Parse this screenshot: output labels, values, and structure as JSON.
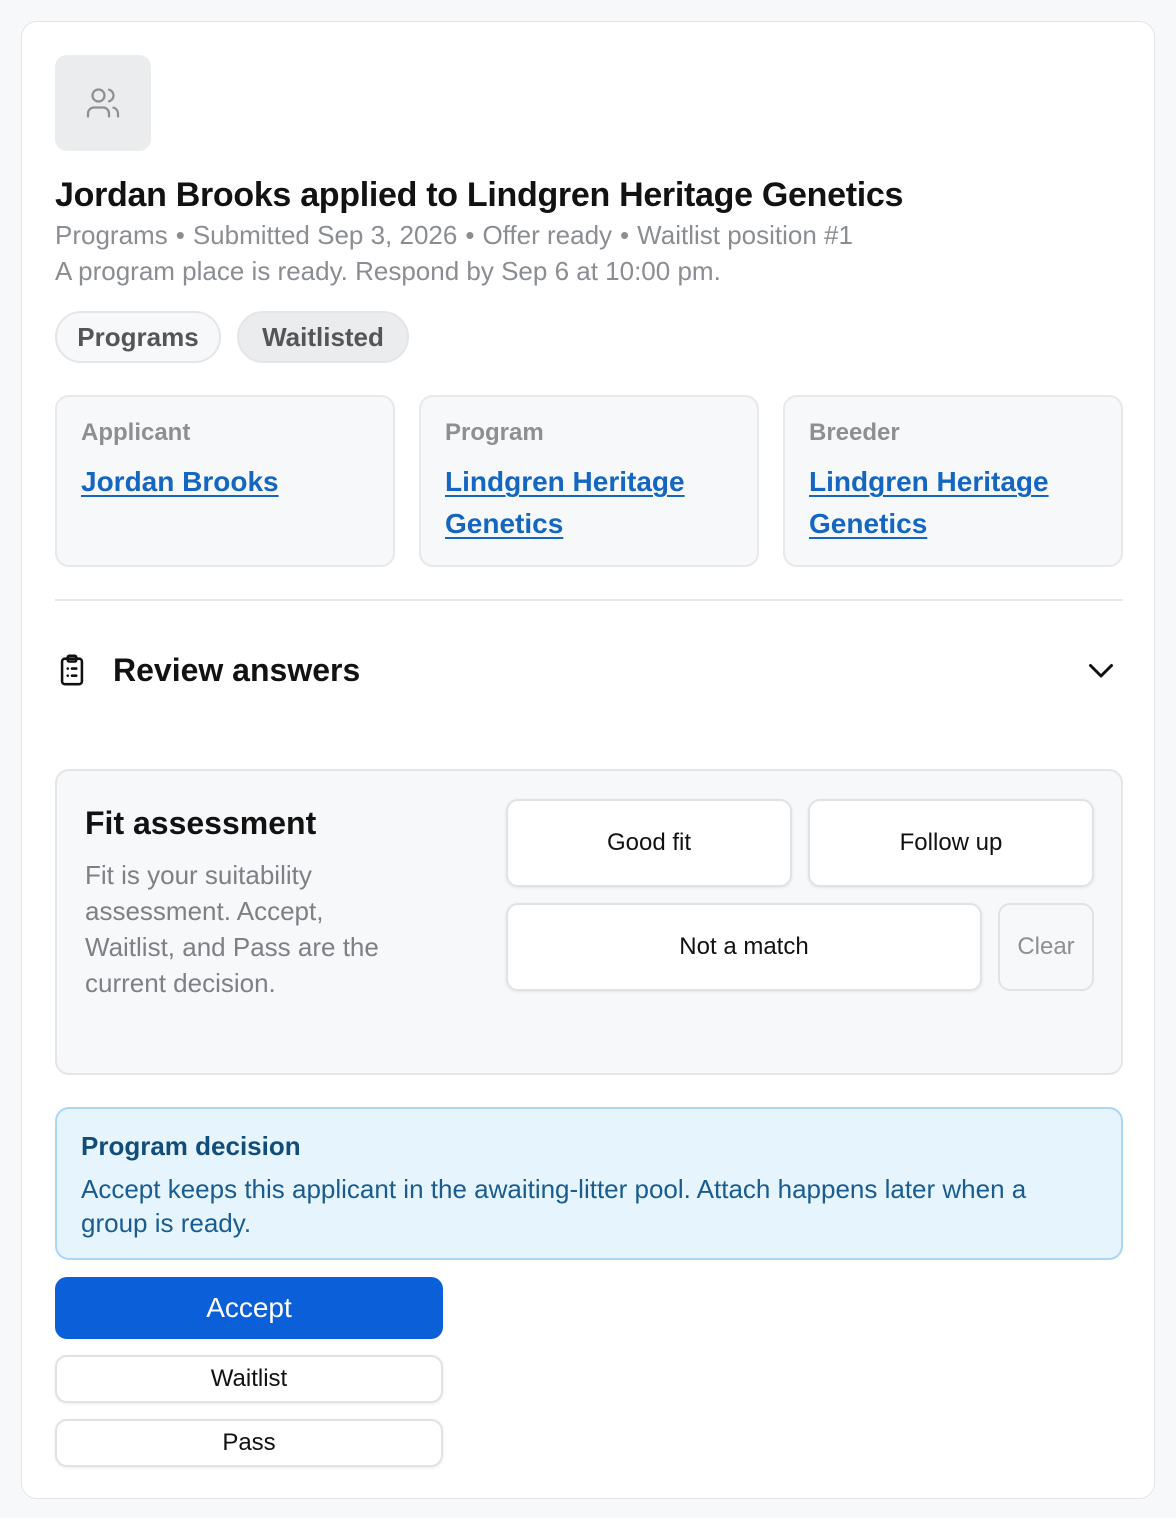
{
  "header": {
    "title": "Jordan Brooks applied to Lindgren Heritage Genetics",
    "meta": [
      "Programs",
      "Submitted Sep 3, 2026",
      "Offer ready",
      "Waitlist position #1"
    ],
    "note": "A program place is ready. Respond by Sep 6 at 10:00 pm."
  },
  "tags": [
    "Programs",
    "Waitlisted"
  ],
  "info_cards": [
    {
      "label": "Applicant",
      "value": "Jordan Brooks"
    },
    {
      "label": "Program",
      "value": "Lindgren Heritage Genetics"
    },
    {
      "label": "Breeder",
      "value": "Lindgren Heritage Genetics"
    }
  ],
  "review": {
    "label": "Review answers"
  },
  "fit": {
    "title": "Fit assessment",
    "description": "Fit is your suitability assessment. Accept, Waitlist, and Pass are the current decision.",
    "options": [
      "Good fit",
      "Follow up",
      "Not a match"
    ],
    "clear_label": "Clear"
  },
  "decision": {
    "title": "Program decision",
    "text": "Accept keeps this applicant in the awaiting-litter pool. Attach happens later when a group is ready."
  },
  "actions": {
    "accept": "Accept",
    "waitlist": "Waitlist",
    "pass": "Pass"
  },
  "colors": {
    "primary": "#0b5fd8",
    "link": "#1466c0",
    "info_bg": "#e6f4fd"
  }
}
